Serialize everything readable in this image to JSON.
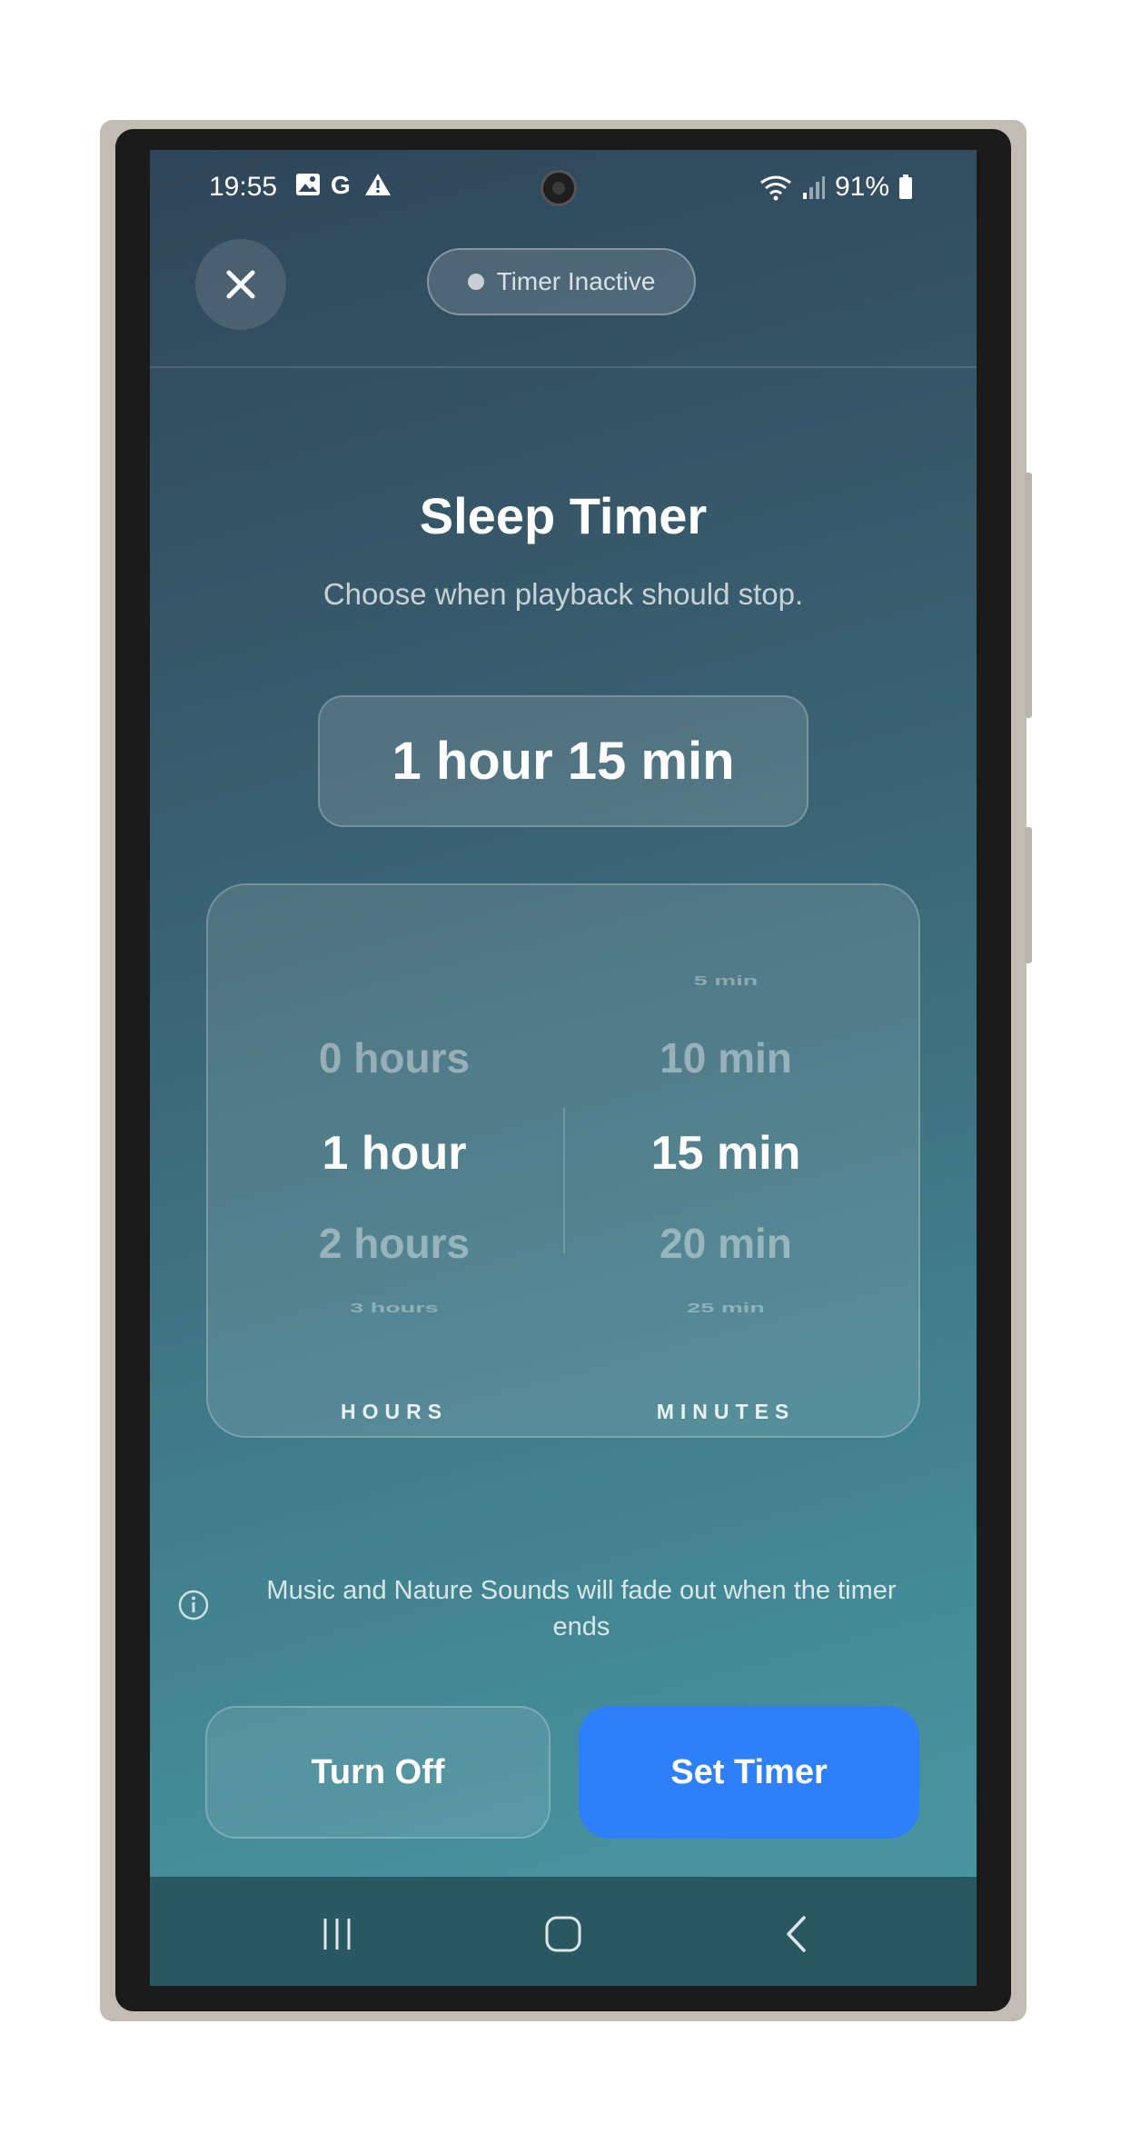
{
  "status_bar": {
    "time": "19:55",
    "battery": "91%"
  },
  "header": {
    "timer_status": "Timer Inactive"
  },
  "main": {
    "title": "Sleep Timer",
    "subtitle": "Choose when playback should stop.",
    "selected_duration": "1 hour 15 min"
  },
  "picker": {
    "hours": {
      "label": "HOURS",
      "items": [
        "0 hours",
        "1 hour",
        "2 hours",
        "3 hours"
      ],
      "selected": "1 hour"
    },
    "minutes": {
      "label": "MINUTES",
      "items": [
        "5 min",
        "10 min",
        "15 min",
        "20 min",
        "25 min"
      ],
      "selected": "15 min"
    }
  },
  "info": {
    "text": "Music and Nature Sounds will fade out when the timer ends"
  },
  "buttons": {
    "turn_off": "Turn Off",
    "set_timer": "Set Timer"
  },
  "colors": {
    "accent": "#2f7ffb",
    "nav_bar": "#2a5862"
  },
  "icons": {
    "close": "close-icon",
    "info": "info-icon",
    "nav_recents": "recents-icon",
    "nav_home": "home-icon",
    "nav_back": "back-icon"
  }
}
